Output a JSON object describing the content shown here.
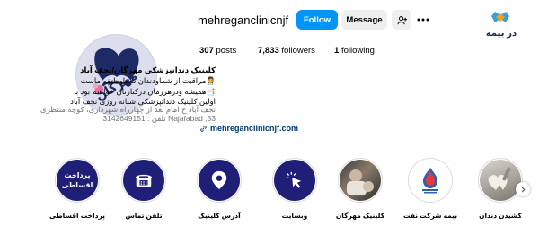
{
  "corner_logo": {
    "text": "در بیمه"
  },
  "profile": {
    "username": "mehreganclinicnjf",
    "follow_label": "Follow",
    "message_label": "Message",
    "adduser_icon": "add-user-icon",
    "more_icon": "more-icon"
  },
  "stats": {
    "posts_count": "307",
    "posts_label": "posts",
    "followers_count": "7,833",
    "followers_label": "followers",
    "following_count": "1",
    "following_label": "following"
  },
  "bio": {
    "name": "کلینیک دندانپزشکی مهرگان/نجف آباد",
    "line1": "👩‍⚕️مراقبت از شماودندان شماوظیفه ماست",
    "line2": "📑همیشه ودرهرزمان درکنارتان خواهیم بود با",
    "line3": "اولین کلینیک دندانپزشکی شبانه روزی نجف آباد",
    "line4": "نجف آباد خ امام بعد از چهارراه شهرداری، کوچه منتظری",
    "line5": "Najafabad ,53 تلفن : 3142649151",
    "link": "mehreganclinicnjf.com"
  },
  "highlights": [
    {
      "label": "پرداخت اقساطی",
      "icon": "installment-text-icon",
      "inner_text": "پرداخت اقساطی"
    },
    {
      "label": "تلفن تماس",
      "icon": "phone-icon"
    },
    {
      "label": "آدرس کلینیک",
      "icon": "location-pin-icon"
    },
    {
      "label": "وبسایت",
      "icon": "cursor-click-icon"
    },
    {
      "label": "کلینیک مهرگان",
      "icon": "clinic-photo-icon"
    },
    {
      "label": "بیمه شرکت نفت",
      "icon": "oil-company-logo-icon"
    },
    {
      "label": "کشیدن دندان",
      "icon": "tooth-extraction-photo-icon"
    }
  ],
  "colors": {
    "follow_blue": "#0095f6",
    "highlight_navy": "#1f1f78",
    "link_blue": "#00376b"
  }
}
